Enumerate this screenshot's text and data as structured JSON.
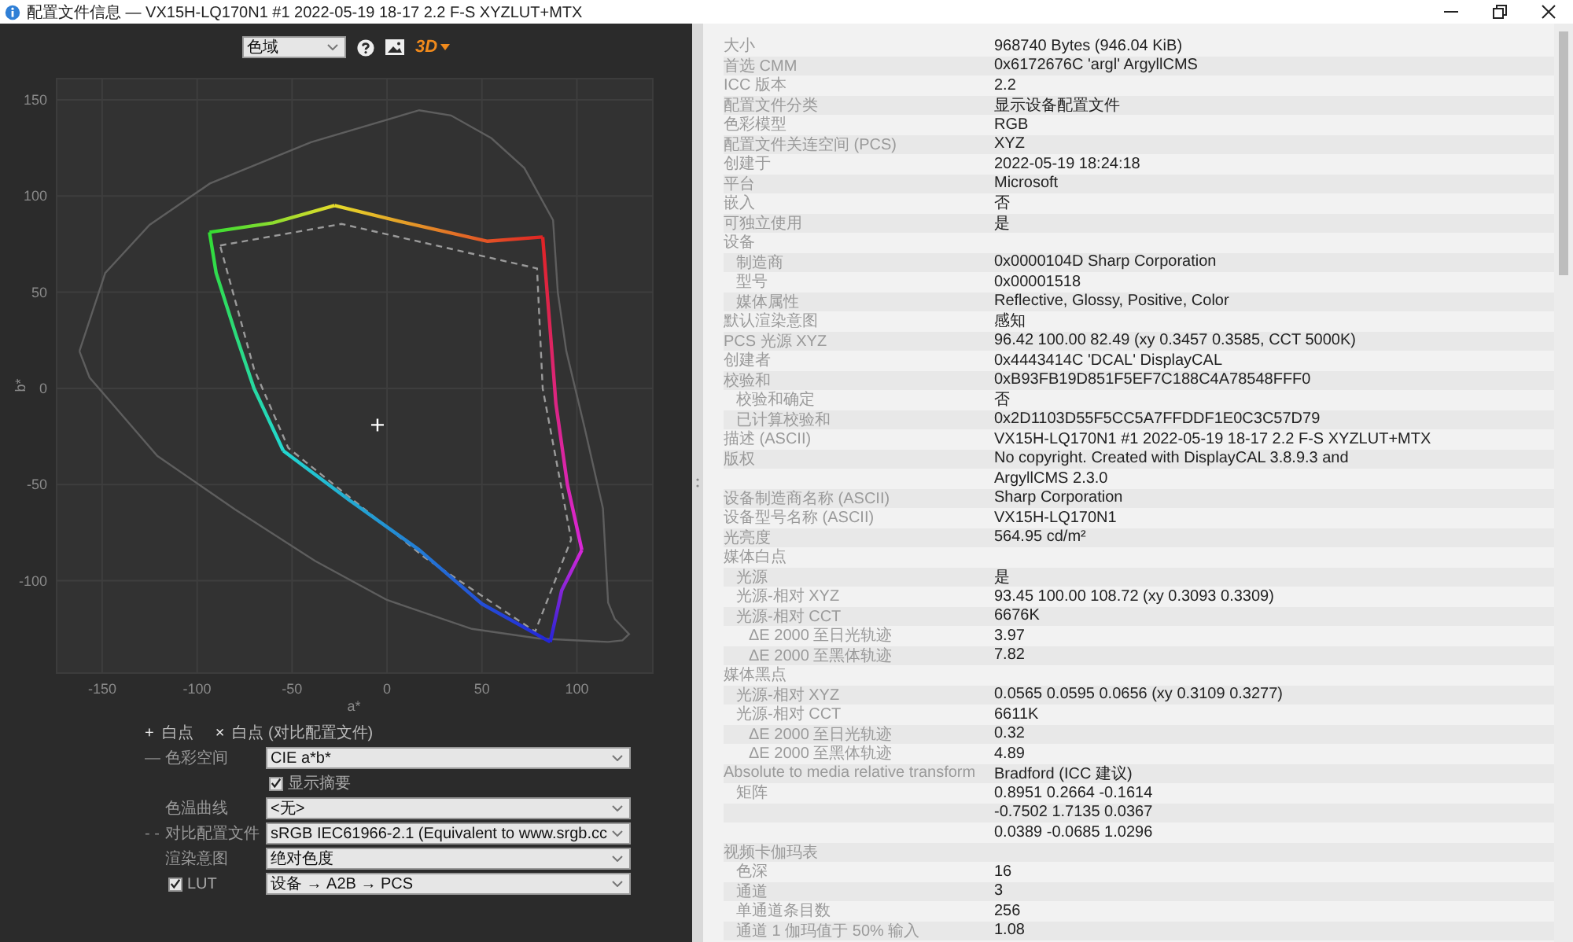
{
  "window": {
    "title": "配置文件信息 — VX15H-LQ170N1 #1 2022-05-19 18-17 2.2 F-S XYZLUT+MTX"
  },
  "toolbar": {
    "view_select": "色域",
    "view_3d_label": "3D"
  },
  "plot": {
    "x_label": "a*",
    "y_label": "b*",
    "x_ticks": [
      "-150",
      "-100",
      "-50",
      "0",
      "50",
      "100"
    ],
    "y_ticks": [
      "150",
      "100",
      "50",
      "0",
      "-50",
      "-100"
    ]
  },
  "legend": [
    {
      "marker": "+",
      "label": "白点"
    },
    {
      "marker": "×",
      "label": "白点 (对比配置文件)"
    }
  ],
  "controls": [
    {
      "kind": "select",
      "marker": "—",
      "label": "色彩空间",
      "value": "CIE a*b*"
    },
    {
      "kind": "checkbox",
      "label": "显示摘要",
      "checked": true
    },
    {
      "kind": "select",
      "label": "色温曲线",
      "value": "<无>"
    },
    {
      "kind": "select",
      "marker": "- -",
      "label": "对比配置文件",
      "value": "sRGB IEC61966-2.1 (Equivalent to www.srgb.cc"
    },
    {
      "kind": "select",
      "label": "渲染意图",
      "value": "绝对色度"
    },
    {
      "kind": "checkselect",
      "label": "LUT",
      "checked": true,
      "value": "设备 → A2B → PCS"
    }
  ],
  "properties": [
    {
      "label": "大小",
      "value": "968740 Bytes (946.04 KiB)"
    },
    {
      "label": "首选 CMM",
      "value": "0x6172676C 'argl' ArgyllCMS"
    },
    {
      "label": "ICC 版本",
      "value": "2.2"
    },
    {
      "label": "配置文件分类",
      "value": "显示设备配置文件"
    },
    {
      "label": "色彩模型",
      "value": "RGB"
    },
    {
      "label": "配置文件关连空间 (PCS)",
      "value": "XYZ"
    },
    {
      "label": "创建于",
      "value": "2022-05-19 18:24:18"
    },
    {
      "label": "平台",
      "value": "Microsoft"
    },
    {
      "label": "嵌入",
      "value": "否"
    },
    {
      "label": "可独立使用",
      "value": "是"
    },
    {
      "label": "设备",
      "children": [
        {
          "label": "制造商",
          "value": "0x0000104D Sharp Corporation"
        },
        {
          "label": "型号",
          "value": "0x00001518"
        },
        {
          "label": "媒体属性",
          "value": "Reflective, Glossy, Positive, Color"
        }
      ]
    },
    {
      "label": "默认渲染意图",
      "value": "感知"
    },
    {
      "label": "PCS 光源 XYZ",
      "value": "96.42 100.00  82.49 (xy 0.3457 0.3585, CCT 5000K)"
    },
    {
      "label": "创建者",
      "value": "0x4443414C 'DCAL' DisplayCAL"
    },
    {
      "label": "校验和",
      "value": "0xB93FB19D851F5EF7C188C4A78548FFF0",
      "children": [
        {
          "label": "校验和确定",
          "value": "否"
        },
        {
          "label": "已计算校验和",
          "value": "0x2D1103D55F5CC5A7FFDDF1E0C3C57D79"
        }
      ]
    },
    {
      "label": "描述 (ASCII)",
      "value": "VX15H-LQ170N1 #1 2022-05-19 18-17 2.2 F-S XYZLUT+MTX"
    },
    {
      "label": "版权",
      "value_lines": [
        "No copyright. Created with DisplayCAL 3.8.9.3 and",
        "ArgyllCMS 2.3.0"
      ]
    },
    {
      "label": "设备制造商名称 (ASCII)",
      "value": "Sharp Corporation"
    },
    {
      "label": "设备型号名称 (ASCII)",
      "value": "VX15H-LQ170N1"
    },
    {
      "label": "光亮度",
      "value": "564.95 cd/m²"
    },
    {
      "label": "媒体白点",
      "children": [
        {
          "label": "光源",
          "value": "是"
        },
        {
          "label": "光源-相对 XYZ",
          "value": "93.45 100.00 108.72 (xy 0.3093 0.3309)"
        },
        {
          "label": "光源-相对 CCT",
          "value": "6676K",
          "children": [
            {
              "label": "ΔE 2000 至日光轨迹",
              "value": "3.97"
            },
            {
              "label": "ΔE 2000 至黑体轨迹",
              "value": "7.82"
            }
          ]
        }
      ]
    },
    {
      "label": "媒体黑点",
      "children": [
        {
          "label": "光源-相对 XYZ",
          "value": "0.0565 0.0595 0.0656 (xy 0.3109 0.3277)"
        },
        {
          "label": "光源-相对 CCT",
          "value": "6611K",
          "children": [
            {
              "label": "ΔE 2000 至日光轨迹",
              "value": "0.32"
            },
            {
              "label": "ΔE 2000 至黑体轨迹",
              "value": "4.89"
            }
          ]
        }
      ]
    },
    {
      "label": "Absolute to media relative transform",
      "value": "Bradford (ICC 建议)",
      "children": [
        {
          "label": "矩阵",
          "value_lines": [
            "0.8951 0.2664 -0.1614",
            "-0.7502 1.7135 0.0367",
            "0.0389 -0.0685 1.0296"
          ]
        }
      ]
    },
    {
      "label": "视频卡伽玛表",
      "children": [
        {
          "label": "色深",
          "value": "16"
        },
        {
          "label": "通道",
          "value": "3"
        },
        {
          "label": "单通道条目数",
          "value": "256"
        },
        {
          "label": "通道 1 伽玛值于 50% 输入",
          "value": "1.08"
        }
      ]
    }
  ]
}
